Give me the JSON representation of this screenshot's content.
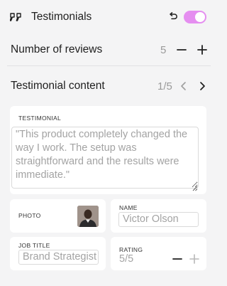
{
  "header": {
    "title": "Testimonials",
    "icon": "quote-icon",
    "undo_icon": "undo-icon",
    "toggle_on": true,
    "accent_color": "#e58ef0"
  },
  "reviews": {
    "label": "Number of reviews",
    "count": "5",
    "minus_icon": "minus-icon",
    "plus_icon": "plus-icon"
  },
  "content": {
    "label": "Testimonial content",
    "pager": "1/5",
    "prev_icon": "chevron-left-icon",
    "next_icon": "chevron-right-icon"
  },
  "testimonial": {
    "label": "TESTIMONIAL",
    "text": "\"This product completely changed the way I work. The setup was straightforward and the results were immediate.\""
  },
  "photo": {
    "label": "PHOTO"
  },
  "name": {
    "label": "NAME",
    "value": "Victor Olson"
  },
  "job_title": {
    "label": "JOB TITLE",
    "value": "Brand Strategist"
  },
  "rating": {
    "label": "RATING",
    "value": "5/5",
    "minus_icon": "minus-icon",
    "plus_icon": "plus-icon"
  }
}
